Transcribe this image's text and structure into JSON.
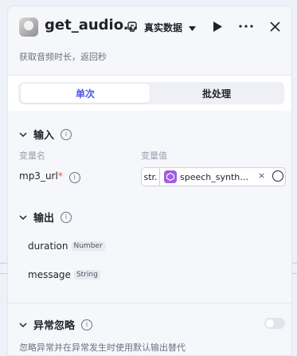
{
  "header": {
    "title": "get_audio…",
    "mode_label": "真实数据",
    "subtitle": "获取音频时长，返回秒"
  },
  "tabs": [
    {
      "label": "单次",
      "active": true
    },
    {
      "label": "批处理",
      "active": false
    }
  ],
  "input_section": {
    "title": "输入",
    "col_name": "变量名",
    "col_value": "变量值",
    "params": [
      {
        "name": "mp3_url",
        "required_mark": "*",
        "type_tag": "str.",
        "value": "speech_synth…"
      }
    ]
  },
  "output_section": {
    "title": "输出",
    "items": [
      {
        "name": "duration",
        "type": "Number"
      },
      {
        "name": "message",
        "type": "String"
      }
    ]
  },
  "exception_section": {
    "title": "异常忽略",
    "description": "忽略异常并在异常发生时使用默认输出替代",
    "enabled": false
  },
  "colors": {
    "accent": "#4d53e8",
    "node_icon": "#a35ce6",
    "required": "#f54a45"
  },
  "icons": [
    "avatar",
    "cube-icon",
    "chevron-down-icon",
    "play-icon",
    "more-icon",
    "close-icon",
    "info-icon",
    "variable-icon"
  ]
}
